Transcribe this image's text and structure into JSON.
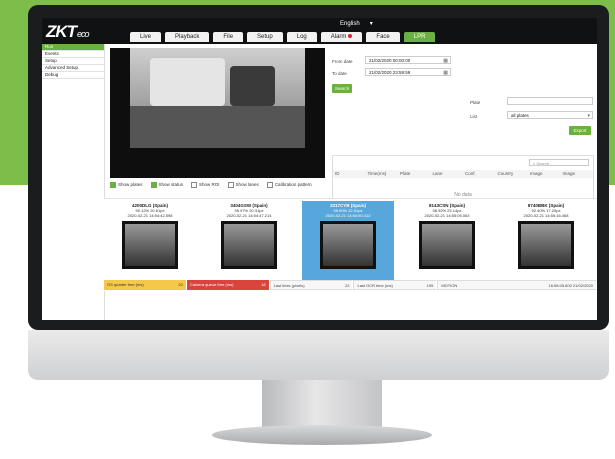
{
  "app": {
    "logo": "ZKT",
    "logo_suffix": "eco",
    "language": "English"
  },
  "nav": {
    "tabs": [
      "Live",
      "Playback",
      "File",
      "Setup",
      "Log",
      "Alarm",
      "Face",
      "LPR"
    ],
    "active": "LPR"
  },
  "sidebar": {
    "items": [
      "Run",
      "Events",
      "Setup",
      "Advanced Setup",
      "Debug"
    ],
    "active": "Run"
  },
  "filters": {
    "from_label": "From date",
    "from_value": "21/02/2020 00:00:00",
    "to_label": "To date",
    "to_value": "21/02/2020 23:59:59",
    "search_button": "Search",
    "plate_label": "Plate",
    "plate_value": "",
    "list_label": "List",
    "list_value": "all plates",
    "export_button": "Export"
  },
  "checks": [
    {
      "label": "Show plates",
      "on": true
    },
    {
      "label": "Show status",
      "on": true
    },
    {
      "label": "Show ROI",
      "on": false
    },
    {
      "label": "Show lanes",
      "on": false
    },
    {
      "label": "Calibration pattern",
      "on": false
    }
  ],
  "table": {
    "search_placeholder": "Search...",
    "columns": [
      "ID",
      "Time(ms)",
      "Plate",
      "Lane",
      "Conf.",
      "Country",
      "Image",
      "Image"
    ],
    "empty_text": "No data"
  },
  "thumbnails": [
    {
      "plate": "4200DLG (Spain)",
      "line2": "90.12% 20.61px",
      "line3": "2020-02-21 14:54:42.598"
    },
    {
      "plate": "3404GSW (Spain)",
      "line2": "95.97% 20.31px",
      "line3": "2020-02-21 14:54:47.214"
    },
    {
      "plate": "3317CYB (Spain)",
      "line2": "99.90% 22.51px",
      "line3": "2020-02-21 14:54:50.412"
    },
    {
      "plate": "8143CSN (Spain)",
      "line2": "98.92% 23.14px",
      "line3": "2020-02-21 14:55:05.063"
    },
    {
      "plate": "8740BBK (Spain)",
      "line2": "92.40% 17.20px",
      "line3": "2020-02-21 14:55:16.468"
    }
  ],
  "selected_thumb": 2,
  "status": {
    "items": [
      {
        "label": "OS quarter free (ms)",
        "value": "20"
      },
      {
        "label": "Camera queue free (ms)",
        "value": "18"
      },
      {
        "label": "Last lines (pixels)",
        "value": "22"
      },
      {
        "label": "Last OCR time (ms)",
        "value": "195"
      },
      {
        "label": "MOTION",
        "value": "16:58:05.600 21/02/2020"
      }
    ]
  },
  "colors": {
    "accent": "#6ab042",
    "selected_thumb": "#58a7dc",
    "status_yellow": "#f6c84a",
    "status_red": "#d9443c",
    "background_band": "#7dbd4a"
  }
}
